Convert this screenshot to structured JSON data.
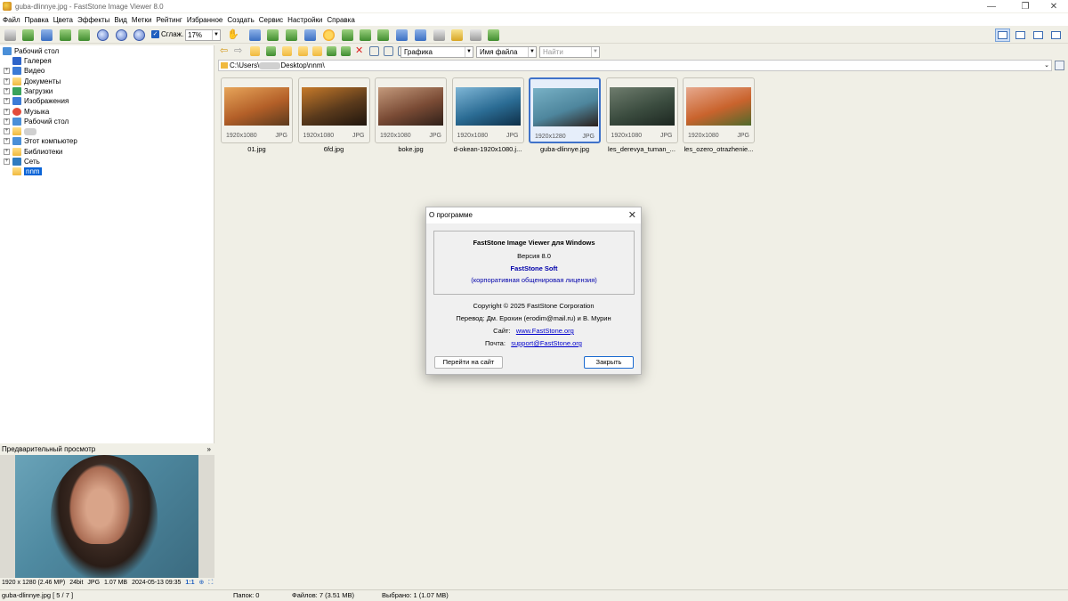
{
  "window": {
    "title": "guba-dlinnye.jpg  -  FastStone Image Viewer 8.0",
    "min": "—",
    "max": "❐",
    "close": "✕"
  },
  "menu": [
    "Файл",
    "Правка",
    "Цвета",
    "Эффекты",
    "Вид",
    "Метки",
    "Рейтинг",
    "Избранное",
    "Создать",
    "Сервис",
    "Настройки",
    "Справка"
  ],
  "toolbar": {
    "smooth_label": "Сглаж.",
    "smooth_checked": true,
    "zoom": "17%"
  },
  "nav": {
    "filter": "Графика",
    "sort": "Имя файла",
    "search_placeholder": "Найти"
  },
  "path": {
    "prefix": "C:\\Users\\",
    "suffix": "Desktop\\nnm\\"
  },
  "tree": {
    "root": "Рабочий стол",
    "items": [
      "Галерея",
      "Видео",
      "Документы",
      "Загрузки",
      "Изображения",
      "Музыка",
      "Рабочий стол",
      "",
      "Этот компьютер",
      "Библиотеки",
      "Сеть",
      "nnm"
    ]
  },
  "preview": {
    "header": "Предварительный просмотр",
    "chevron": "»"
  },
  "image_info": {
    "dims": "1920 x 1280 (2.46 MP)",
    "bits": "24bit",
    "format": "JPG",
    "size": "1.07 MB",
    "date": "2024-05-13 09:35",
    "ratio": "1:1"
  },
  "status": {
    "file": "guba-dlinnye.jpg [ 5 / 7 ]",
    "folders": "Папок: 0",
    "files": "Файлов: 7 (3.51 MB)",
    "selected": "Выбрано: 1 (1.07 MB)"
  },
  "thumbs": [
    {
      "name": "01.jpg",
      "dims": "1920x1080",
      "ext": "JPG",
      "selected": false,
      "colors": [
        "#e7a55a",
        "#b35f28",
        "#5b3a1d"
      ]
    },
    {
      "name": "6fd.jpg",
      "dims": "1920x1080",
      "ext": "JPG",
      "selected": false,
      "colors": [
        "#c77a2a",
        "#5a3a1c",
        "#1f150d"
      ]
    },
    {
      "name": "boke.jpg",
      "dims": "1920x1080",
      "ext": "JPG",
      "selected": false,
      "colors": [
        "#c49a7c",
        "#7a4b35",
        "#2f2019"
      ]
    },
    {
      "name": "d-okean-1920x1080.j...",
      "dims": "1920x1080",
      "ext": "JPG",
      "selected": false,
      "colors": [
        "#7fb6d6",
        "#2b6c94",
        "#0e2f48"
      ]
    },
    {
      "name": "guba-dlinnye.jpg",
      "dims": "1920x1280",
      "ext": "JPG",
      "selected": true,
      "colors": [
        "#78b1c6",
        "#4e869d",
        "#2b1f1a"
      ]
    },
    {
      "name": "les_derevya_tuman_...",
      "dims": "1920x1080",
      "ext": "JPG",
      "selected": false,
      "colors": [
        "#6f7d6e",
        "#3b4c3f",
        "#1c2620"
      ]
    },
    {
      "name": "les_ozero_otrazhenie...",
      "dims": "1920x1080",
      "ext": "JPG",
      "selected": false,
      "colors": [
        "#e7a98e",
        "#c9632d",
        "#4f6a2c"
      ]
    }
  ],
  "dialog": {
    "title": "О программе",
    "product": "FastStone Image Viewer для Windows",
    "version": "Версия 8.0",
    "company": "FastStone Soft",
    "license": "(корпоративная общенировая лицензия)",
    "copyright": "Copyright © 2025 FastStone Corporation",
    "translation": "Перевод: Дм. Ерохин (erodim@mail.ru) и В. Мурин",
    "site_label": "Сайт:",
    "site": "www.FastStone.org",
    "mail_label": "Почта:",
    "mail": "support@FastStone.org",
    "btn_site": "Перейти на сайт",
    "btn_close": "Закрыть",
    "colors": {
      "company": "#0000aa",
      "link": "#0000cc"
    }
  }
}
